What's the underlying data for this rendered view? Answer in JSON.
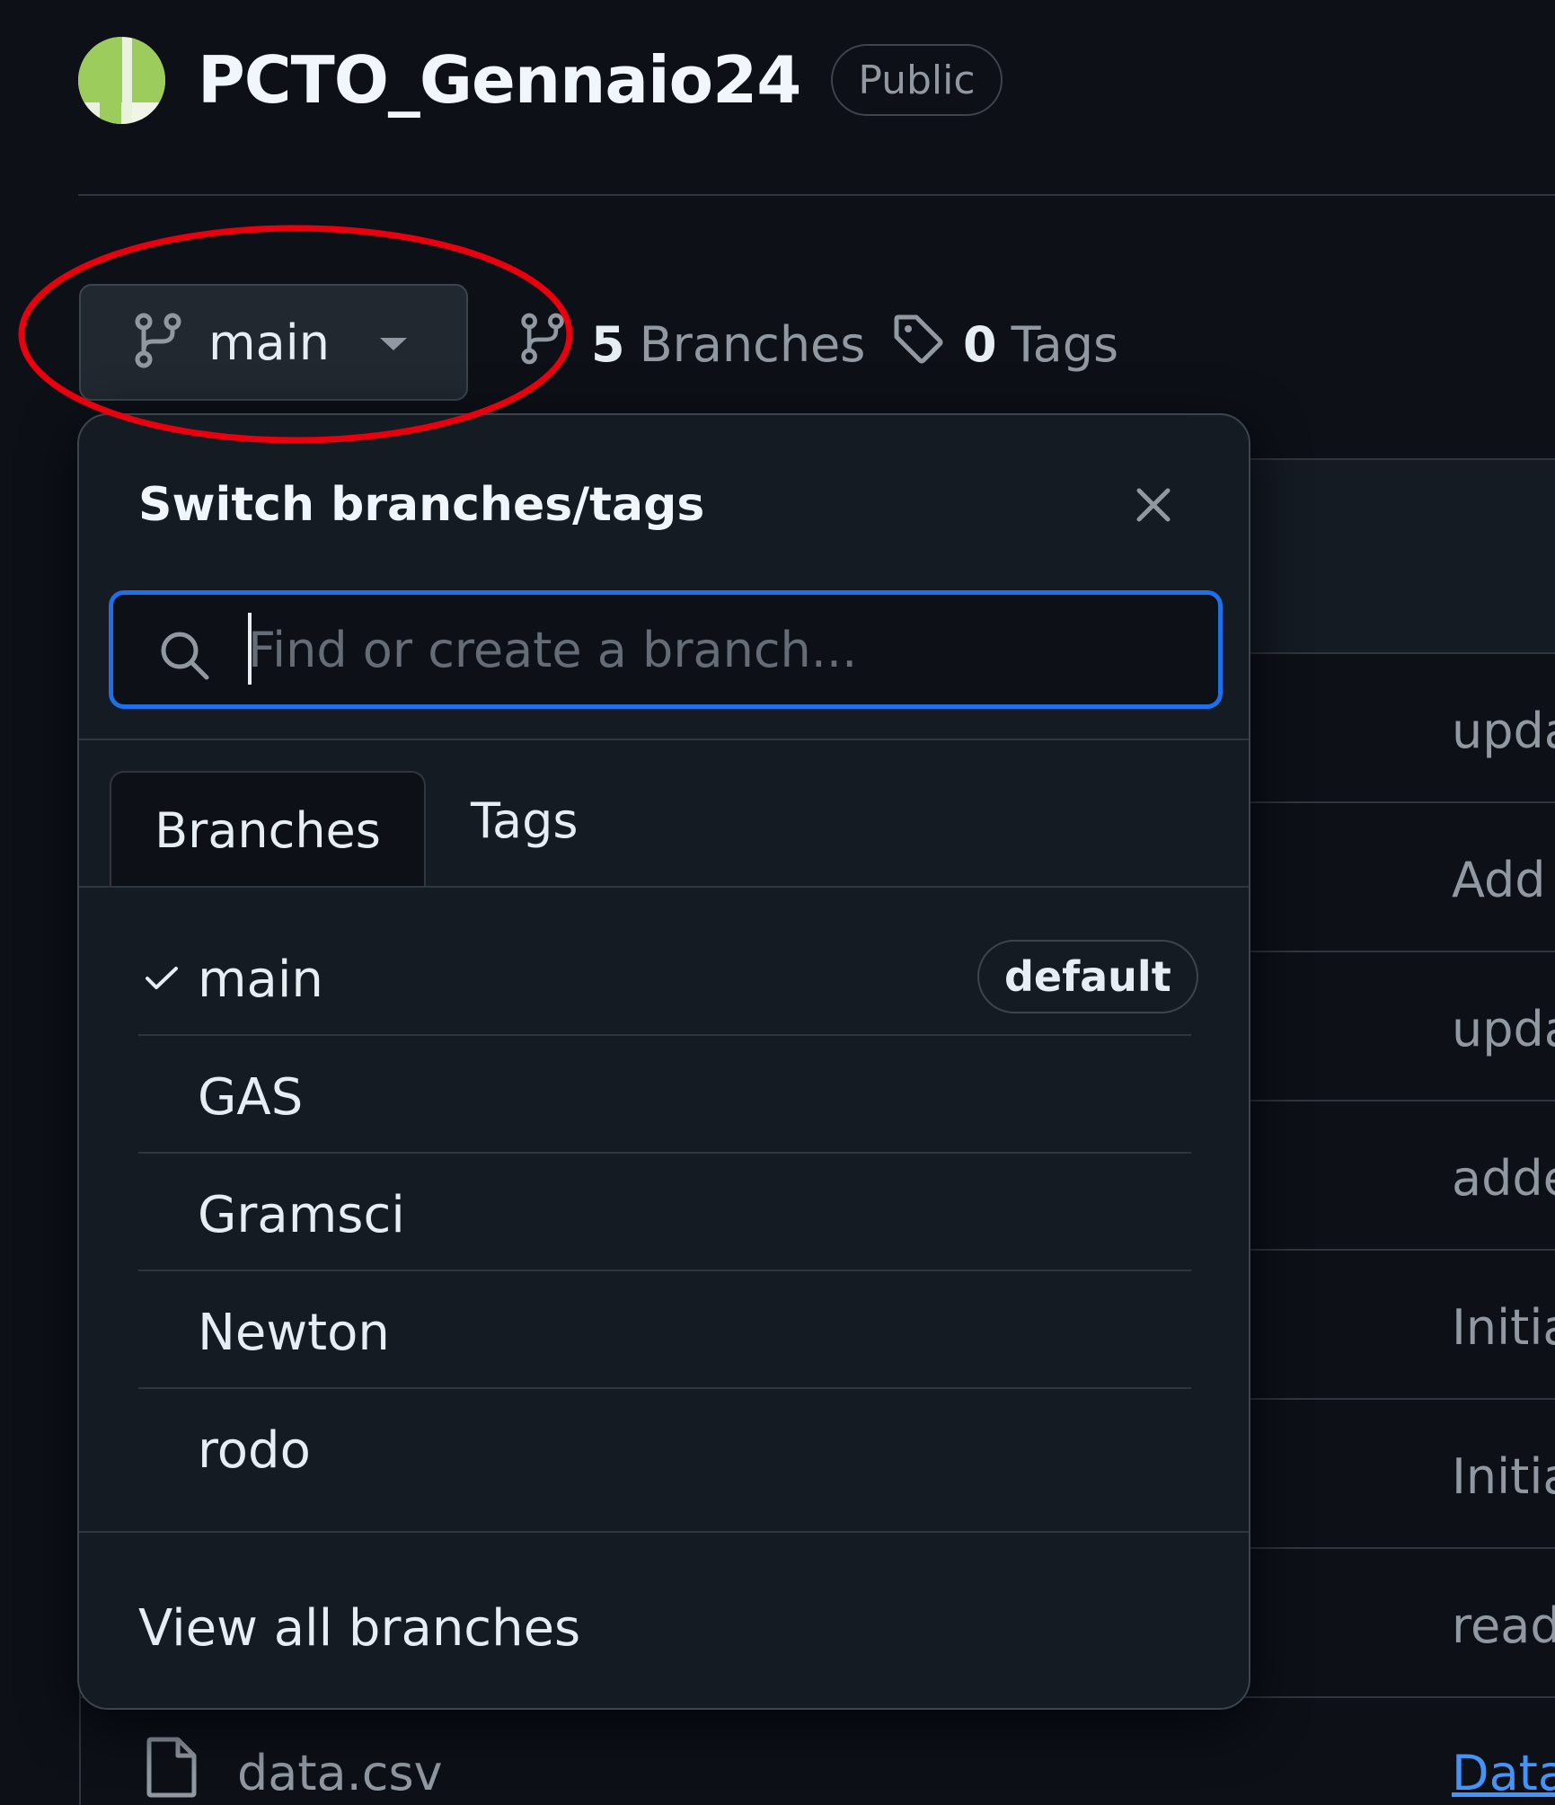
{
  "repo": {
    "name": "PCTO_Gennaio24",
    "visibility": "Public"
  },
  "branch_bar": {
    "current_branch": "main",
    "branch_count": "5",
    "branches_label": "Branches",
    "tag_count": "0",
    "tags_label": "Tags"
  },
  "dropdown": {
    "title": "Switch branches/tags",
    "search_placeholder": "Find or create a branch...",
    "tabs": [
      "Branches",
      "Tags"
    ],
    "active_tab": "Branches",
    "branches": [
      {
        "label": "main",
        "checked": true,
        "badge": "default"
      },
      {
        "label": "GAS"
      },
      {
        "label": "Gramsci"
      },
      {
        "label": "Newton"
      },
      {
        "label": "rodo"
      }
    ],
    "view_all_label": "View all branches"
  },
  "file_table": {
    "commit_messages": [
      "upda",
      "Add",
      "upda",
      "adde",
      "Initia",
      "Initia",
      "read"
    ],
    "visible_file": {
      "name": "data.csv",
      "commit": "Data"
    }
  },
  "colors": {
    "background": "#0d1117",
    "overlay": "#151b23",
    "focus_ring": "#1f6feb",
    "annotation": "#e8000f",
    "link": "#4493f8"
  }
}
